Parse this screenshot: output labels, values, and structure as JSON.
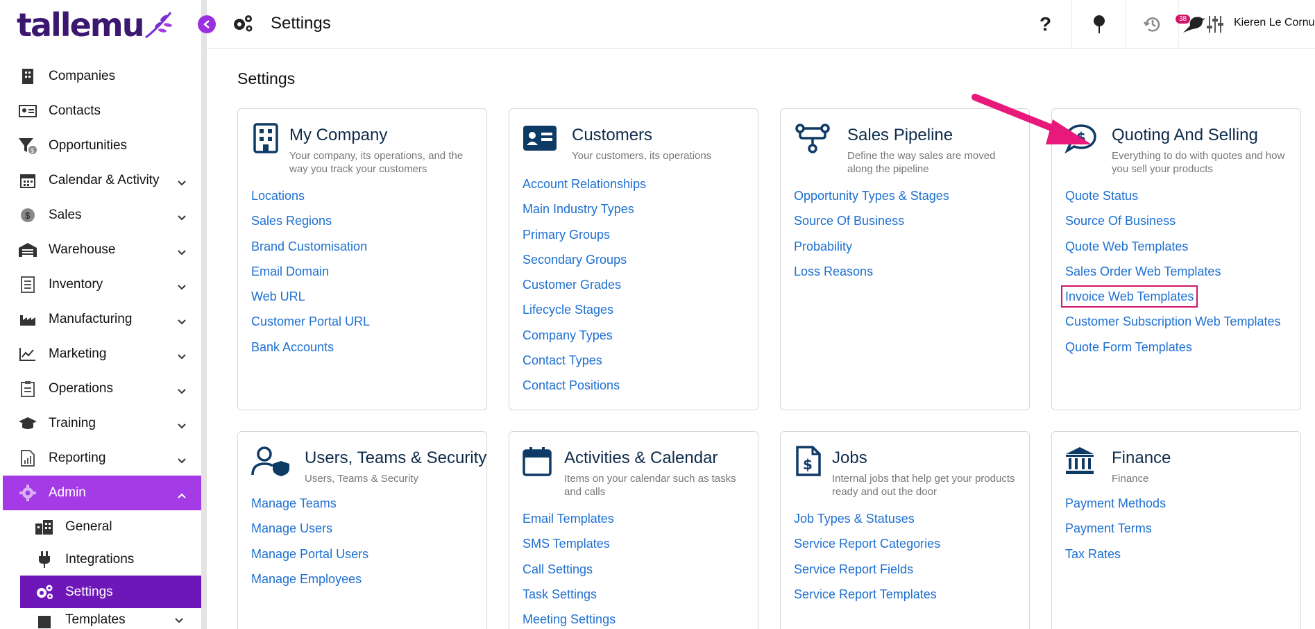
{
  "app": {
    "logo_text": "tallemu",
    "page_title": "Settings",
    "user_name": "Kieren Le Cornu",
    "notification_count": "38"
  },
  "sidebar": {
    "items": [
      {
        "label": "Companies"
      },
      {
        "label": "Contacts"
      },
      {
        "label": "Opportunities"
      },
      {
        "label": "Calendar & Activity"
      },
      {
        "label": "Sales"
      },
      {
        "label": "Warehouse"
      },
      {
        "label": "Inventory"
      },
      {
        "label": "Manufacturing"
      },
      {
        "label": "Marketing"
      },
      {
        "label": "Operations"
      },
      {
        "label": "Training"
      },
      {
        "label": "Reporting"
      },
      {
        "label": "Admin"
      }
    ],
    "admin_sub": [
      {
        "label": "General"
      },
      {
        "label": "Integrations"
      },
      {
        "label": "Settings"
      },
      {
        "label": "Templates"
      }
    ]
  },
  "content": {
    "heading": "Settings",
    "cards": [
      {
        "title": "My Company",
        "desc": "Your company, its operations, and the way you track your customers",
        "links": [
          "Locations",
          "Sales Regions",
          "Brand Customisation",
          "Email Domain",
          "Web URL",
          "Customer Portal URL",
          "Bank Accounts"
        ]
      },
      {
        "title": "Customers",
        "desc": "Your customers, its operations",
        "links": [
          "Account Relationships",
          "Main Industry Types",
          "Primary Groups",
          "Secondary Groups",
          "Customer Grades",
          "Lifecycle Stages",
          "Company Types",
          "Contact Types",
          "Contact Positions"
        ]
      },
      {
        "title": "Sales Pipeline",
        "desc": "Define the way sales are moved along the pipeline",
        "links": [
          "Opportunity Types & Stages",
          "Source Of Business",
          "Probability",
          "Loss Reasons"
        ]
      },
      {
        "title": "Quoting And Selling",
        "desc": "Everything to do with quotes and how you sell your products",
        "links": [
          "Quote Status",
          "Source Of Business",
          "Quote Web Templates",
          "Sales Order Web Templates",
          "Invoice Web Templates",
          "Customer Subscription Web Templates",
          "Quote Form Templates"
        ]
      },
      {
        "title": "Users, Teams & Security",
        "desc": "Users, Teams & Security",
        "links": [
          "Manage Teams",
          "Manage Users",
          "Manage Portal Users",
          "Manage Employees"
        ]
      },
      {
        "title": "Activities & Calendar",
        "desc": "Items on your calendar such as tasks and calls",
        "links": [
          "Email Templates",
          "SMS Templates",
          "Call Settings",
          "Task Settings",
          "Meeting Settings"
        ]
      },
      {
        "title": "Jobs",
        "desc": "Internal jobs that help get your products ready and out the door",
        "links": [
          "Job Types & Statuses",
          "Service Report Categories",
          "Service Report Fields",
          "Service Report Templates"
        ]
      },
      {
        "title": "Finance",
        "desc": "Finance",
        "links": [
          "Payment Methods",
          "Payment Terms",
          "Tax Rates"
        ]
      }
    ]
  },
  "colors": {
    "accent": "#a53be6",
    "accent_dark": "#6d17b8",
    "link": "#1d6fd1",
    "annotation": "#e8197a"
  }
}
